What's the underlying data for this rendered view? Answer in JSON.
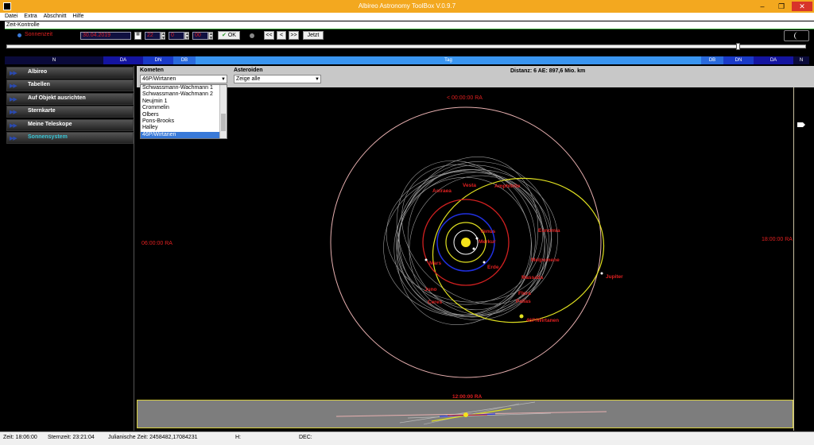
{
  "window": {
    "title": "Albireo Astronomy ToolBox V.0.9.7"
  },
  "menu": [
    "Datei",
    "Extra",
    "Abschnitt",
    "Hilfe"
  ],
  "panel": {
    "title": "Zeit-Kontrolle"
  },
  "time_controls": {
    "mode_label": "Sonnenzeit",
    "date": "30.04.2019",
    "hour": "22",
    "minute": "0",
    "second": "00",
    "ok_label": "OK",
    "rewind_label": "<<",
    "back_label": "<",
    "forward_label": ">",
    "fastforward_label": ">>",
    "now_label": "Jetzt"
  },
  "timeline": [
    {
      "label": "N",
      "color": "#0a0a3a"
    },
    {
      "label": "DA",
      "color": "#1414a0"
    },
    {
      "label": "DN",
      "color": "#1a3ac8"
    },
    {
      "label": "DB",
      "color": "#2a6adc"
    },
    {
      "label": "Tag",
      "color": "#3a95f0"
    },
    {
      "label": "DB",
      "color": "#2a6adc"
    },
    {
      "label": "DN",
      "color": "#1a3ac8"
    },
    {
      "label": "DA",
      "color": "#1414a0"
    },
    {
      "label": "N",
      "color": "#0a0a3a"
    }
  ],
  "sidebar": {
    "items": [
      {
        "label": "Albireo"
      },
      {
        "label": "Tabellen"
      },
      {
        "label": "Auf Objekt ausrichten"
      },
      {
        "label": "Sternkarte"
      },
      {
        "label": "Meine Teleskope"
      },
      {
        "label": "Sonnensystem"
      }
    ]
  },
  "filters": {
    "comets_label": "Kometen",
    "comets_selected": "46P/Wirtanen",
    "comets_options": [
      "Schwassmann-Wachmann 1",
      "Schwassmann-Wachmann 2",
      "Neujmin 1",
      "Crommelin",
      "Olbers",
      "Pons-Brooks",
      "Halley",
      "46P/Wirtanen"
    ],
    "asteroids_label": "Asteroiden",
    "asteroids_selected": "Zeige alle",
    "distance": "Distanz: 6 AE: 897,6 Mio. km"
  },
  "orbit_view": {
    "ra_top": "< 00:00:00 RA",
    "ra_left": "06:00:00 RA",
    "ra_right": "18:00:00 RA",
    "ra_bottom": "12:00:00 RA",
    "bodies": [
      "Vesta",
      "Amphitrite",
      "Astraea",
      "Venus",
      "Merkur",
      "Eunomia",
      "Erde",
      "Melpomene",
      "Mars",
      "Massalia",
      "Jupiter",
      "Juno",
      "Ceres",
      "Flora",
      "Pallas",
      "46P/Wirtanen"
    ]
  },
  "status": {
    "time": "Zeit: 18:06:00",
    "sidereal": "Sternzeit: 23:21:04",
    "julian": "Julianische Zeit: 2458482,17084231",
    "h": "H:",
    "dec": "DEC:"
  }
}
